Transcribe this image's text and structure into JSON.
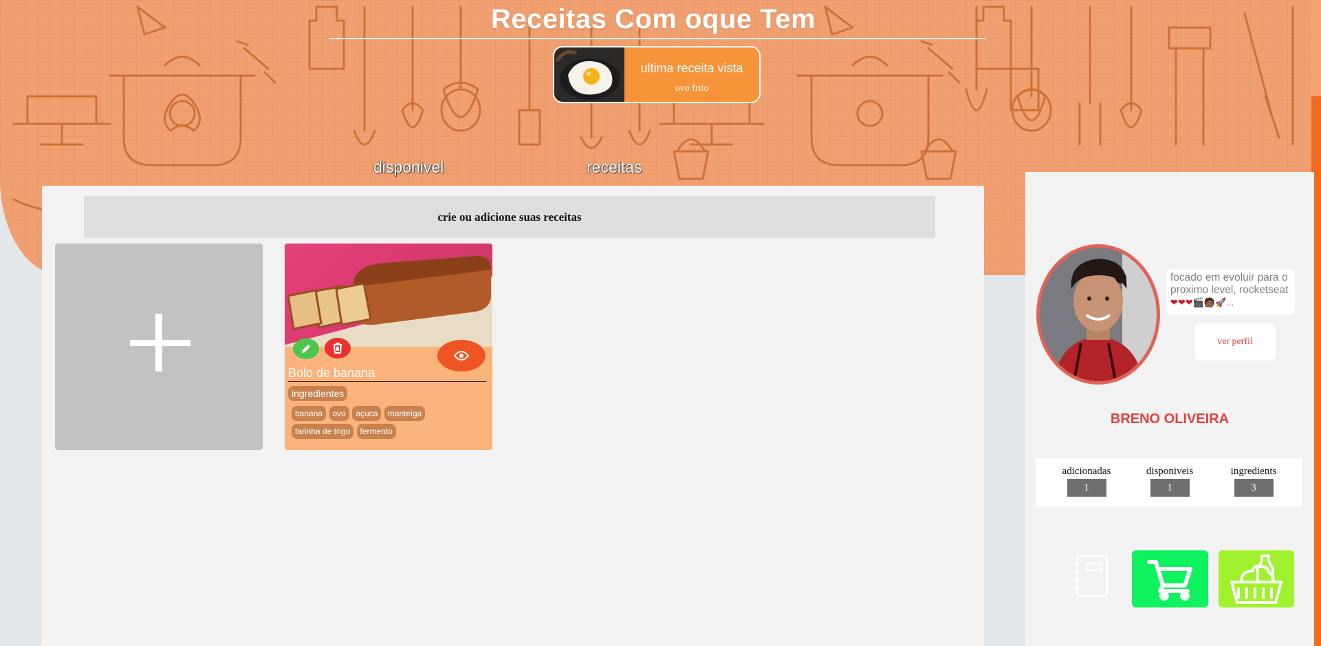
{
  "header": {
    "title": "Receitas Com oque Tem",
    "last_viewed": {
      "label": "ultima receita vista",
      "recipe": "ovo frito",
      "image_icon": "fried-egg-image"
    }
  },
  "tabs": [
    {
      "label": "disponivel"
    },
    {
      "label": "receitas"
    }
  ],
  "main": {
    "banner": "crie ou adicione suas receitas",
    "add_card_icon": "plus-icon",
    "recipes": [
      {
        "name": "Bolo de banana",
        "image_icon": "banana-bread-image",
        "ingredients_label": "ingredientes",
        "ingredients": [
          "banana",
          "ovo",
          "açuca",
          "manteiga",
          "farinha de trigo",
          "fermento"
        ]
      }
    ]
  },
  "profile": {
    "bio": "focado em evoluir para o proximo level, rocketseat",
    "bio_emojis": "❤❤❤🎬🧑🏾🚀...",
    "profile_button": "ver perfil",
    "name": "BRENO OLIVEIRA",
    "stats": [
      {
        "label": "adicionadas",
        "value": "1"
      },
      {
        "label": "disponiveis",
        "value": "1"
      },
      {
        "label": "ingredients",
        "value": "3"
      }
    ],
    "action_icons": [
      "notebook-icon",
      "shopping-cart-icon",
      "grocery-basket-icon"
    ]
  },
  "colors": {
    "header_orange": "#f0a070",
    "accent_red": "#e3413c",
    "card_orange": "#f9b37b",
    "cart_green": "#0df25e",
    "basket_lime": "#9ff22d",
    "view_button": "#ee5522"
  }
}
